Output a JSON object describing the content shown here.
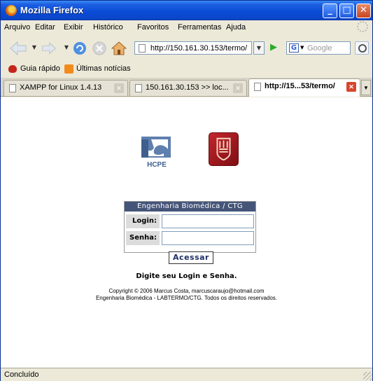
{
  "window": {
    "title": "Mozilla Firefox",
    "minimize": "_",
    "maximize": "□",
    "close": "✕"
  },
  "menu": [
    "Arquivo",
    "Editar",
    "Exibir",
    "Histórico",
    "Favoritos",
    "Ferramentas",
    "Ajuda"
  ],
  "nav": {
    "url": "http://150.161.30.153/termo/",
    "search_placeholder": "Google"
  },
  "bookmarks": [
    {
      "label": "Guia rápido",
      "icon": "getting-started-icon"
    },
    {
      "label": "Últimas notícias",
      "icon": "rss-icon"
    }
  ],
  "tabs": [
    {
      "label": "XAMPP for Linux 1.4.13",
      "active": false
    },
    {
      "label": "150.161.30.153 >> loc...",
      "active": false
    },
    {
      "label": "http://15...53/termo/",
      "active": true
    }
  ],
  "content": {
    "logo_text": "HCPE",
    "form_title": "Engenharia Biomédica / CTG",
    "login_label": "Login:",
    "password_label": "Senha:",
    "login_value": "",
    "password_value": "",
    "submit_label": "Acessar",
    "prompt": "Digite seu Login e Senha.",
    "copyright_line1": "Copyright © 2006 Marcus Costa, marcuscaraujo@hotmail.com",
    "copyright_line2": "Engenharia Biomédica - LABTERMO/CTG. Todos os direitos reservados."
  },
  "status": "Concluído",
  "colors": {
    "titlebar": "#0a4bd6",
    "form_header": "#45557a",
    "ufpe_logo": "#a8181e"
  }
}
